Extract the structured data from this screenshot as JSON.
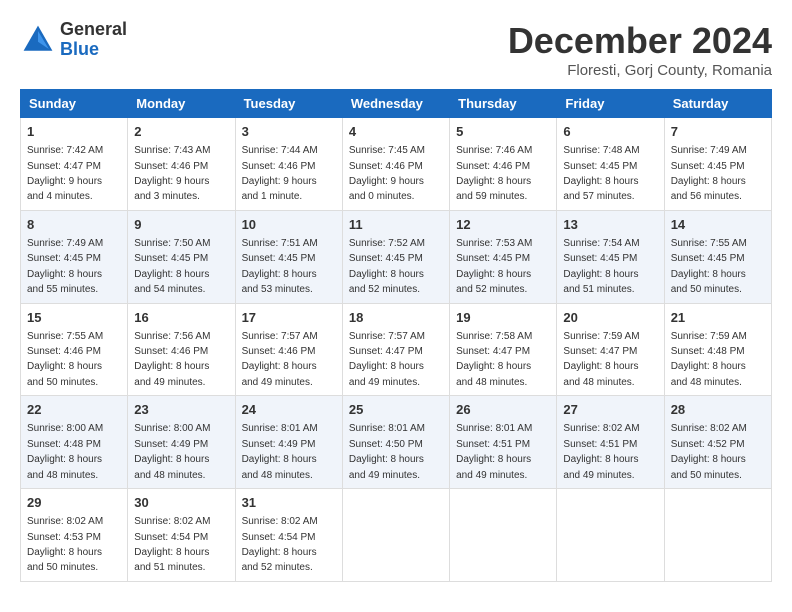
{
  "header": {
    "logo_general": "General",
    "logo_blue": "Blue",
    "month_title": "December 2024",
    "location": "Floresti, Gorj County, Romania"
  },
  "days_of_week": [
    "Sunday",
    "Monday",
    "Tuesday",
    "Wednesday",
    "Thursday",
    "Friday",
    "Saturday"
  ],
  "weeks": [
    [
      {
        "day": "1",
        "sunrise": "7:42 AM",
        "sunset": "4:47 PM",
        "daylight": "9 hours and 4 minutes."
      },
      {
        "day": "2",
        "sunrise": "7:43 AM",
        "sunset": "4:46 PM",
        "daylight": "9 hours and 3 minutes."
      },
      {
        "day": "3",
        "sunrise": "7:44 AM",
        "sunset": "4:46 PM",
        "daylight": "9 hours and 1 minute."
      },
      {
        "day": "4",
        "sunrise": "7:45 AM",
        "sunset": "4:46 PM",
        "daylight": "9 hours and 0 minutes."
      },
      {
        "day": "5",
        "sunrise": "7:46 AM",
        "sunset": "4:46 PM",
        "daylight": "8 hours and 59 minutes."
      },
      {
        "day": "6",
        "sunrise": "7:48 AM",
        "sunset": "4:45 PM",
        "daylight": "8 hours and 57 minutes."
      },
      {
        "day": "7",
        "sunrise": "7:49 AM",
        "sunset": "4:45 PM",
        "daylight": "8 hours and 56 minutes."
      }
    ],
    [
      {
        "day": "8",
        "sunrise": "7:49 AM",
        "sunset": "4:45 PM",
        "daylight": "8 hours and 55 minutes."
      },
      {
        "day": "9",
        "sunrise": "7:50 AM",
        "sunset": "4:45 PM",
        "daylight": "8 hours and 54 minutes."
      },
      {
        "day": "10",
        "sunrise": "7:51 AM",
        "sunset": "4:45 PM",
        "daylight": "8 hours and 53 minutes."
      },
      {
        "day": "11",
        "sunrise": "7:52 AM",
        "sunset": "4:45 PM",
        "daylight": "8 hours and 52 minutes."
      },
      {
        "day": "12",
        "sunrise": "7:53 AM",
        "sunset": "4:45 PM",
        "daylight": "8 hours and 52 minutes."
      },
      {
        "day": "13",
        "sunrise": "7:54 AM",
        "sunset": "4:45 PM",
        "daylight": "8 hours and 51 minutes."
      },
      {
        "day": "14",
        "sunrise": "7:55 AM",
        "sunset": "4:45 PM",
        "daylight": "8 hours and 50 minutes."
      }
    ],
    [
      {
        "day": "15",
        "sunrise": "7:55 AM",
        "sunset": "4:46 PM",
        "daylight": "8 hours and 50 minutes."
      },
      {
        "day": "16",
        "sunrise": "7:56 AM",
        "sunset": "4:46 PM",
        "daylight": "8 hours and 49 minutes."
      },
      {
        "day": "17",
        "sunrise": "7:57 AM",
        "sunset": "4:46 PM",
        "daylight": "8 hours and 49 minutes."
      },
      {
        "day": "18",
        "sunrise": "7:57 AM",
        "sunset": "4:47 PM",
        "daylight": "8 hours and 49 minutes."
      },
      {
        "day": "19",
        "sunrise": "7:58 AM",
        "sunset": "4:47 PM",
        "daylight": "8 hours and 48 minutes."
      },
      {
        "day": "20",
        "sunrise": "7:59 AM",
        "sunset": "4:47 PM",
        "daylight": "8 hours and 48 minutes."
      },
      {
        "day": "21",
        "sunrise": "7:59 AM",
        "sunset": "4:48 PM",
        "daylight": "8 hours and 48 minutes."
      }
    ],
    [
      {
        "day": "22",
        "sunrise": "8:00 AM",
        "sunset": "4:48 PM",
        "daylight": "8 hours and 48 minutes."
      },
      {
        "day": "23",
        "sunrise": "8:00 AM",
        "sunset": "4:49 PM",
        "daylight": "8 hours and 48 minutes."
      },
      {
        "day": "24",
        "sunrise": "8:01 AM",
        "sunset": "4:49 PM",
        "daylight": "8 hours and 48 minutes."
      },
      {
        "day": "25",
        "sunrise": "8:01 AM",
        "sunset": "4:50 PM",
        "daylight": "8 hours and 49 minutes."
      },
      {
        "day": "26",
        "sunrise": "8:01 AM",
        "sunset": "4:51 PM",
        "daylight": "8 hours and 49 minutes."
      },
      {
        "day": "27",
        "sunrise": "8:02 AM",
        "sunset": "4:51 PM",
        "daylight": "8 hours and 49 minutes."
      },
      {
        "day": "28",
        "sunrise": "8:02 AM",
        "sunset": "4:52 PM",
        "daylight": "8 hours and 50 minutes."
      }
    ],
    [
      {
        "day": "29",
        "sunrise": "8:02 AM",
        "sunset": "4:53 PM",
        "daylight": "8 hours and 50 minutes."
      },
      {
        "day": "30",
        "sunrise": "8:02 AM",
        "sunset": "4:54 PM",
        "daylight": "8 hours and 51 minutes."
      },
      {
        "day": "31",
        "sunrise": "8:02 AM",
        "sunset": "4:54 PM",
        "daylight": "8 hours and 52 minutes."
      },
      null,
      null,
      null,
      null
    ]
  ]
}
